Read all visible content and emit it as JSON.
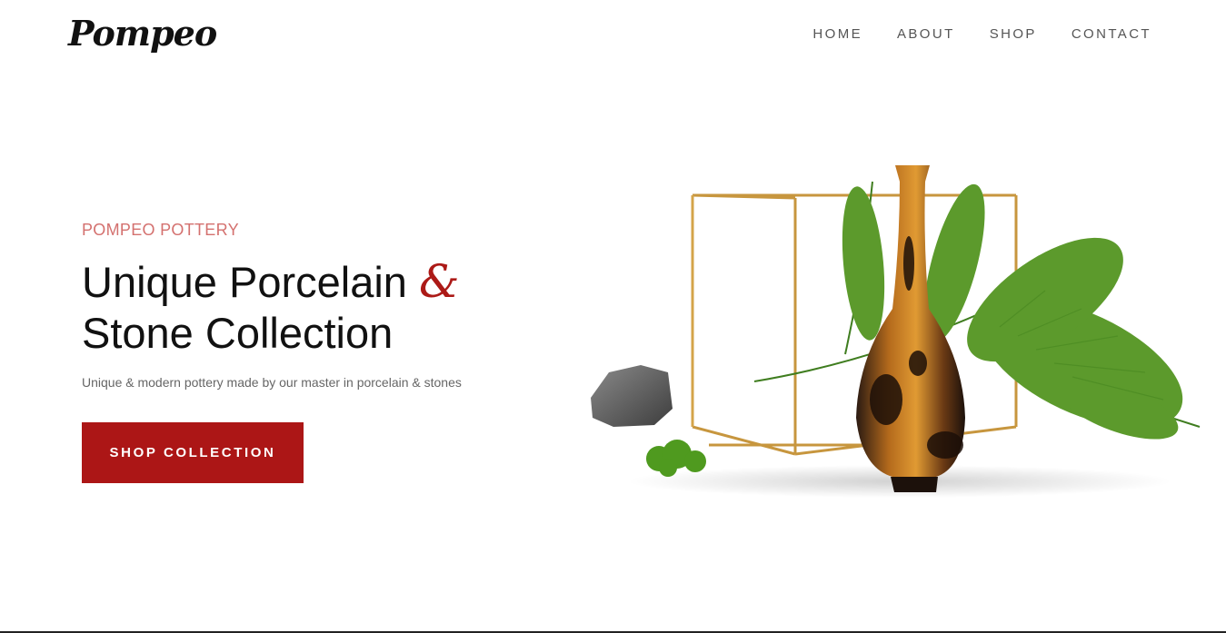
{
  "header": {
    "logo": "Pompeo",
    "nav": [
      {
        "label": "HOME"
      },
      {
        "label": "ABOUT"
      },
      {
        "label": "SHOP"
      },
      {
        "label": "CONTACT"
      }
    ]
  },
  "hero": {
    "eyebrow": "POMPEO POTTERY",
    "headline_line1": "Unique Porcelain",
    "headline_amp": "&",
    "headline_line2": "Stone Collection",
    "subtext": "Unique & modern pottery made by our master in porcelain & stones",
    "cta_label": "SHOP COLLECTION"
  },
  "colors": {
    "accent": "#ac1616",
    "eyebrow": "#d4716f",
    "text": "#111111",
    "nav": "#555555"
  }
}
